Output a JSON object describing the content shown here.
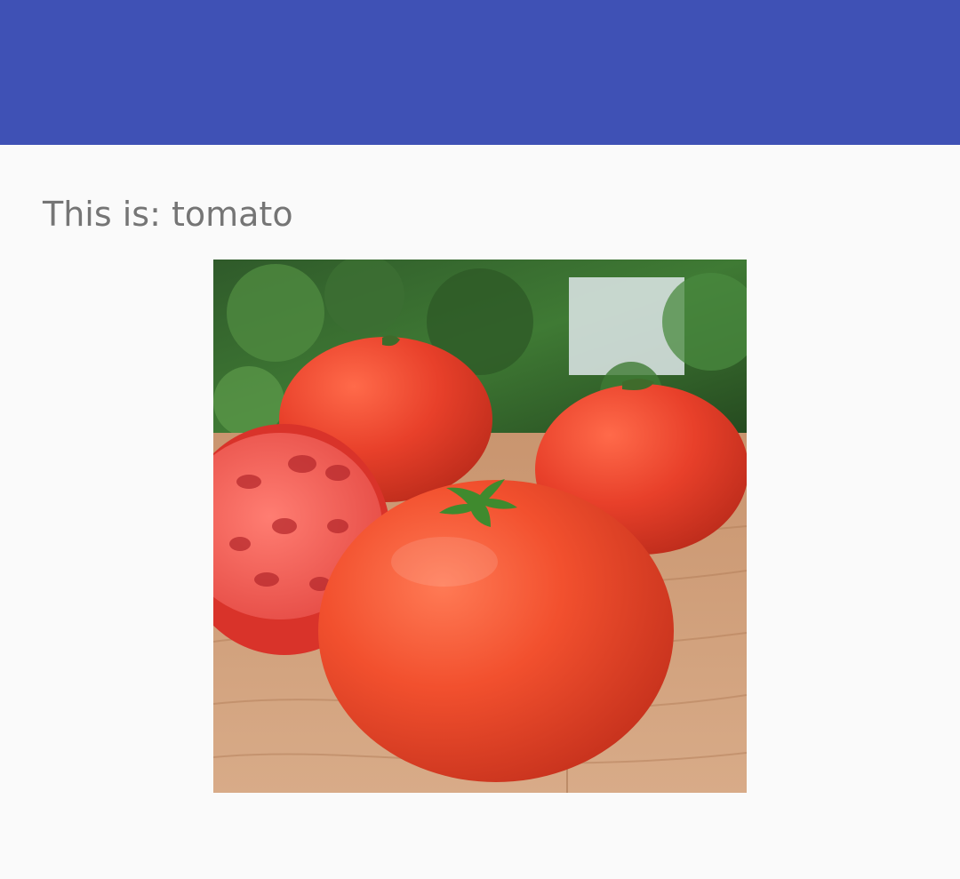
{
  "app_bar": {
    "color": "#3f51b5"
  },
  "result": {
    "label": "This is: tomato"
  },
  "image": {
    "subject": "tomato",
    "icon": "photo-of-tomatoes"
  }
}
